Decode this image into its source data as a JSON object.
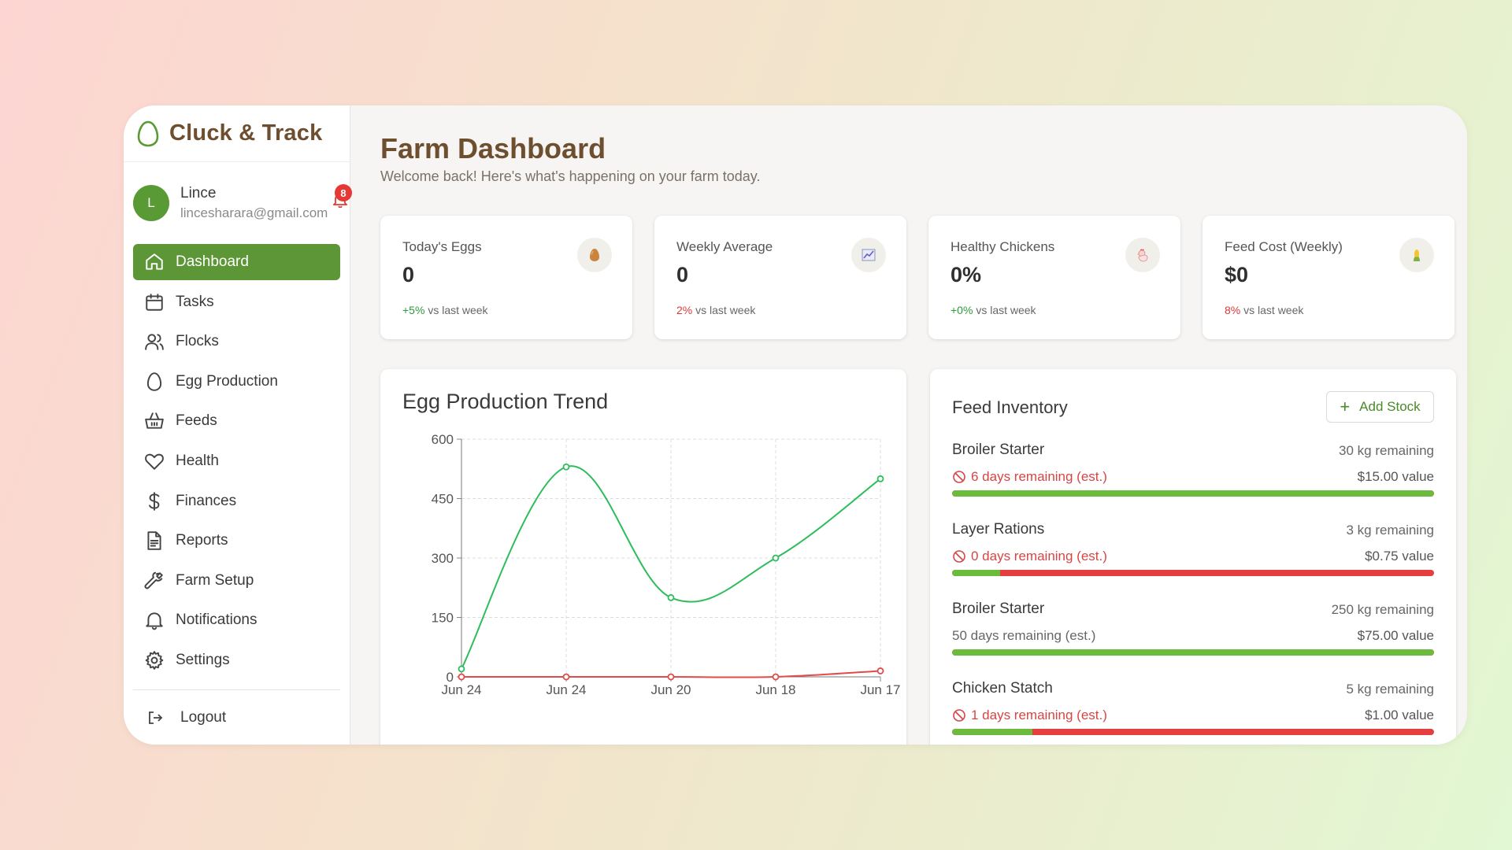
{
  "app": {
    "name": "Cluck & Track"
  },
  "user": {
    "initial": "L",
    "name": "Lince",
    "email": "lincesharara@gmail.com",
    "notification_count": "8"
  },
  "nav": [
    {
      "label": "Dashboard",
      "icon": "home-icon",
      "active": true
    },
    {
      "label": "Tasks",
      "icon": "calendar-icon"
    },
    {
      "label": "Flocks",
      "icon": "users-icon"
    },
    {
      "label": "Egg Production",
      "icon": "egg-icon"
    },
    {
      "label": "Feeds",
      "icon": "basket-icon"
    },
    {
      "label": "Health",
      "icon": "heart-icon"
    },
    {
      "label": "Finances",
      "icon": "dollar-icon"
    },
    {
      "label": "Reports",
      "icon": "document-icon"
    },
    {
      "label": "Farm Setup",
      "icon": "wrench-icon"
    },
    {
      "label": "Notifications",
      "icon": "bell-icon"
    },
    {
      "label": "Settings",
      "icon": "gear-icon"
    }
  ],
  "logout": {
    "label": "Logout"
  },
  "page": {
    "title": "Farm Dashboard",
    "subtitle": "Welcome back! Here's what's happening on your farm today."
  },
  "stats": [
    {
      "label": "Today's Eggs",
      "value": "0",
      "change": "+5%",
      "change_type": "pos",
      "suffix": "vs last week",
      "icon": "egg-icon"
    },
    {
      "label": "Weekly Average",
      "value": "0",
      "change": "2%",
      "change_type": "neg",
      "suffix": "vs last week",
      "icon": "chart-icon"
    },
    {
      "label": "Healthy Chickens",
      "value": "0%",
      "change": "+0%",
      "change_type": "pos",
      "suffix": "vs last week",
      "icon": "chicken-icon"
    },
    {
      "label": "Feed Cost (Weekly)",
      "value": "$0",
      "change": "8%",
      "change_type": "neg",
      "suffix": "vs last week",
      "icon": "corn-icon"
    }
  ],
  "chart": {
    "title": "Egg Production Trend"
  },
  "chart_data": {
    "type": "line",
    "title": "Egg Production Trend",
    "categories": [
      "Jun 24",
      "Jun 24",
      "Jun 20",
      "Jun 18",
      "Jun 17"
    ],
    "ylim": [
      0,
      600
    ],
    "yticks": [
      0,
      150,
      300,
      450,
      600
    ],
    "grid": true,
    "series": [
      {
        "values": [
          20,
          530,
          200,
          300,
          500
        ],
        "color": "#2ebd5c"
      },
      {
        "values": [
          0,
          0,
          0,
          0,
          15
        ],
        "color": "#e04b4b"
      }
    ]
  },
  "feed": {
    "title": "Feed Inventory",
    "add_label": "Add Stock",
    "items": [
      {
        "name": "Broiler Starter",
        "remaining": "30 kg remaining",
        "days": "6 days remaining (est.)",
        "warn": true,
        "value": "$15.00 value",
        "level": 1.0
      },
      {
        "name": "Layer Rations",
        "remaining": "3 kg remaining",
        "days": "0 days remaining (est.)",
        "warn": true,
        "value": "$0.75 value",
        "level": 0.1
      },
      {
        "name": "Broiler Starter",
        "remaining": "250 kg remaining",
        "days": "50 days remaining (est.)",
        "warn": false,
        "value": "$75.00 value",
        "level": 1.0
      },
      {
        "name": "Chicken Statch",
        "remaining": "5 kg remaining",
        "days": "1 days remaining (est.)",
        "warn": true,
        "value": "$1.00 value",
        "level": 0.167
      }
    ]
  },
  "colors": {
    "brand": "#6d4f2f",
    "accent": "#5d9636",
    "danger": "#e53e3e",
    "ok": "#6dbb3d"
  }
}
